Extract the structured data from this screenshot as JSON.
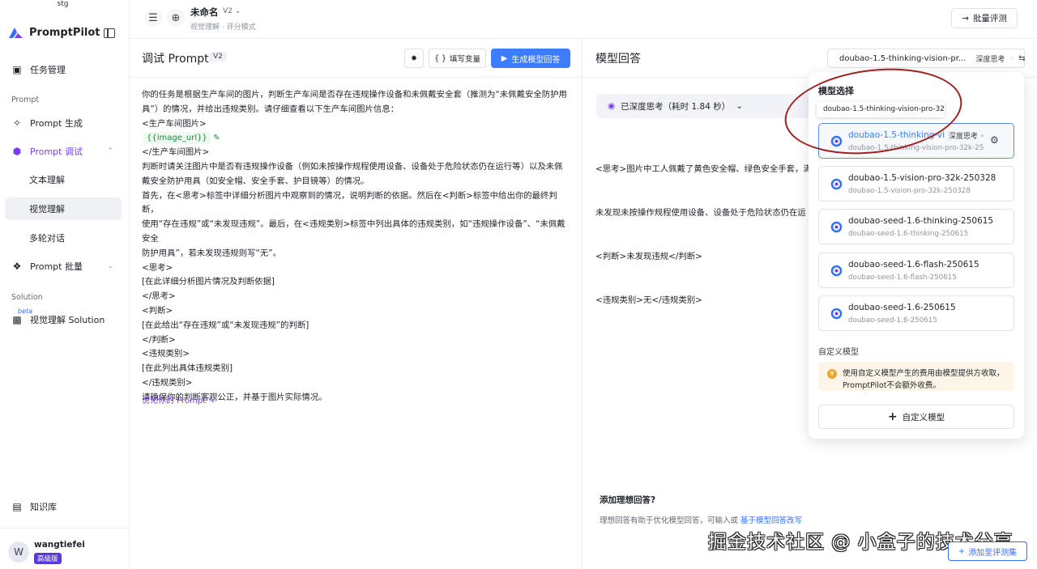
{
  "sidebar": {
    "env": "stg",
    "brand": "PromptPilot",
    "items": {
      "tasks": "任务管理",
      "prompt_section": "Prompt",
      "prompt_gen": "Prompt 生成",
      "prompt_debug": "Prompt 调试",
      "text": "文本理解",
      "visual": "视觉理解",
      "multi": "多轮对话",
      "batch": "Prompt 批量",
      "solution_section": "Solution",
      "beta": "beta",
      "visual_solution": "视觉理解 Solution",
      "kb": "知识库"
    },
    "user": {
      "avatar": "W",
      "name": "wangtiefei",
      "plan": "高级版"
    }
  },
  "topbar": {
    "title": "未命名",
    "version": "V2",
    "breadcrumb": "视觉理解 · 评分模式",
    "batch_eval": "批量评测"
  },
  "left": {
    "title": "调试 Prompt",
    "version_tag": "V2",
    "fill_vars": "填写变量",
    "generate": "生成模型回答",
    "prompt_lines": [
      "你的任务是根据生产车间的图片，判断生产车间是否存在违规操作设备和未佩戴安全套（推测为“未佩戴安全防护用",
      "具”）的情况，并给出违规类别。请仔细查看以下生产车间图片信息：",
      "<生产车间图片>"
    ],
    "variable": "{{image_url}}",
    "prompt_lines_2": [
      "</生产车间图片>",
      "判断时请关注图片中是否有违规操作设备（例如未按操作规程使用设备、设备处于危险状态仍在运行等）以及未佩",
      "戴安全防护用具（如安全帽、安全手套、护目镜等）的情况。",
      "首先，在<思考>标签中详细分析图片中观察到的情况，说明判断的依据。然后在<判断>标签中给出你的最终判断，",
      "使用“存在违规”或“未发现违规”。最后，在<违规类别>标签中列出具体的违规类别，如“违规操作设备”、“未佩戴安全",
      "防护用具”，若未发现违规则写“无”。",
      "<思考>",
      "[在此详细分析图片情况及判断依据]",
      "</思考>",
      "<判断>",
      "[在此给出“存在违规”或“未发现违规”的判断]",
      "</判断>",
      "<违规类别>",
      "[在此列出具体违规类别]",
      "</违规类别>",
      "请确保你的判断客观公正，并基于图片实际情况。"
    ],
    "optimize": "优化你的 Prompt"
  },
  "right": {
    "title": "模型回答",
    "model_selected": "doubao-1.5-thinking-vision-pr...",
    "deep_think": "深度思考",
    "thinking_status": "已深度思考（耗时 1.84 秒）",
    "answer_lines": [
      "<思考>图片中工人佩戴了黄色安全帽、绿色安全手套，满",
      "未发现未按操作规程使用设备、设备处于危险状态仍在运",
      "<判断>未发现违规</判断>",
      "<违规类别>无</违规类别>"
    ],
    "ideal_title": "添加理想回答?",
    "ideal_desc": "理想回答有助于优化模型回答，可输入或",
    "ideal_link": "基于模型回答改写",
    "add_eval": "添加至评测集"
  },
  "panel": {
    "title": "模型选择",
    "tooltip": "doubao-1.5-thinking-vision-pro-32k-250428",
    "models": [
      {
        "name": "doubao-1.5-thinking-vi...",
        "id": "doubao-1.5-thinking-vision-pro-32k-2504...",
        "deep": "深度思考"
      },
      {
        "name": "doubao-1.5-vision-pro-32k-250328",
        "id": "doubao-1.5-vision-pro-32k-250328"
      },
      {
        "name": "doubao-seed-1.6-thinking-250615",
        "id": "doubao-seed-1.6-thinking-250615"
      },
      {
        "name": "doubao-seed-1.6-flash-250615",
        "id": "doubao-seed-1.6-flash-250615"
      },
      {
        "name": "doubao-seed-1.6-250615",
        "id": "doubao-seed-1.6-250615"
      }
    ],
    "custom_title": "自定义模型",
    "notice": "使用自定义模型产生的费用由模型提供方收取，PromptPilot不会额外收费。",
    "custom_button": "自定义模型"
  },
  "watermark": "掘金技术社区 @ 小盒子的技术分享",
  "colors": {
    "accent": "#3d7bff",
    "purple": "#7a3cf6",
    "annotation": "#a11f1f"
  }
}
